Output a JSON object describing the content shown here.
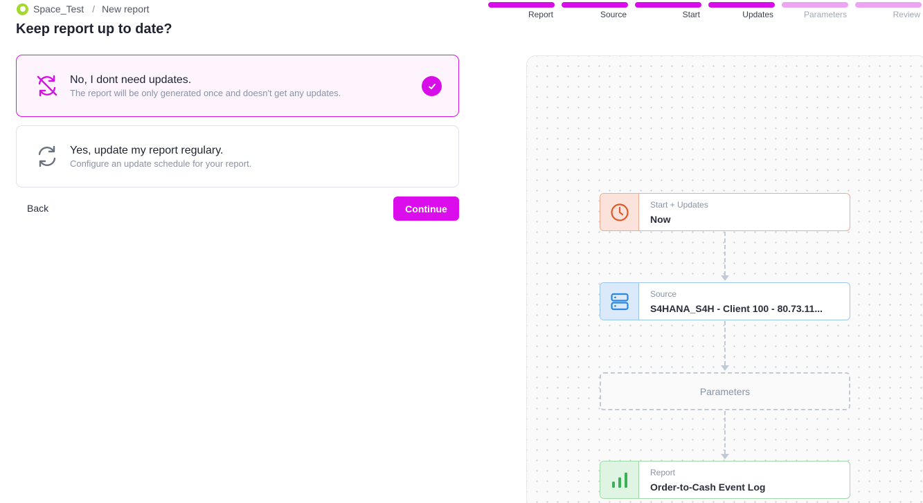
{
  "breadcrumb": {
    "space": "Space_Test",
    "separator": "/",
    "page": "New report"
  },
  "page_title": "Keep report up to date?",
  "options": [
    {
      "title": "No, I dont need updates.",
      "description": "The report will be only generated once and doesn't get any updates.",
      "icon": "sync-off-icon",
      "selected": true
    },
    {
      "title": "Yes, update my report regulary.",
      "description": "Configure an update schedule for your report.",
      "icon": "sync-icon",
      "selected": false
    }
  ],
  "actions": {
    "back_label": "Back",
    "continue_label": "Continue"
  },
  "steps": [
    {
      "label": "Report",
      "state": "complete"
    },
    {
      "label": "Source",
      "state": "complete"
    },
    {
      "label": "Start",
      "state": "complete"
    },
    {
      "label": "Updates",
      "state": "complete"
    },
    {
      "label": "Parameters",
      "state": "upcoming"
    },
    {
      "label": "Review",
      "state": "upcoming"
    }
  ],
  "flow": {
    "start": {
      "label": "Start + Updates",
      "value": "Now",
      "icon": "clock-icon"
    },
    "source": {
      "label": "Source",
      "value": "S4HANA_S4H - Client 100 - 80.73.11...",
      "icon": "server-icon"
    },
    "parameters": {
      "label": "Parameters"
    },
    "report": {
      "label": "Report",
      "value": "Order-to-Cash Event Log",
      "icon": "bar-chart-icon"
    }
  },
  "colors": {
    "accent": "#d80ee8",
    "accent_light": "#eda4f3",
    "start_node": "#f0a992",
    "source_node": "#9cc5ee",
    "report_node": "#9fd9a8"
  }
}
